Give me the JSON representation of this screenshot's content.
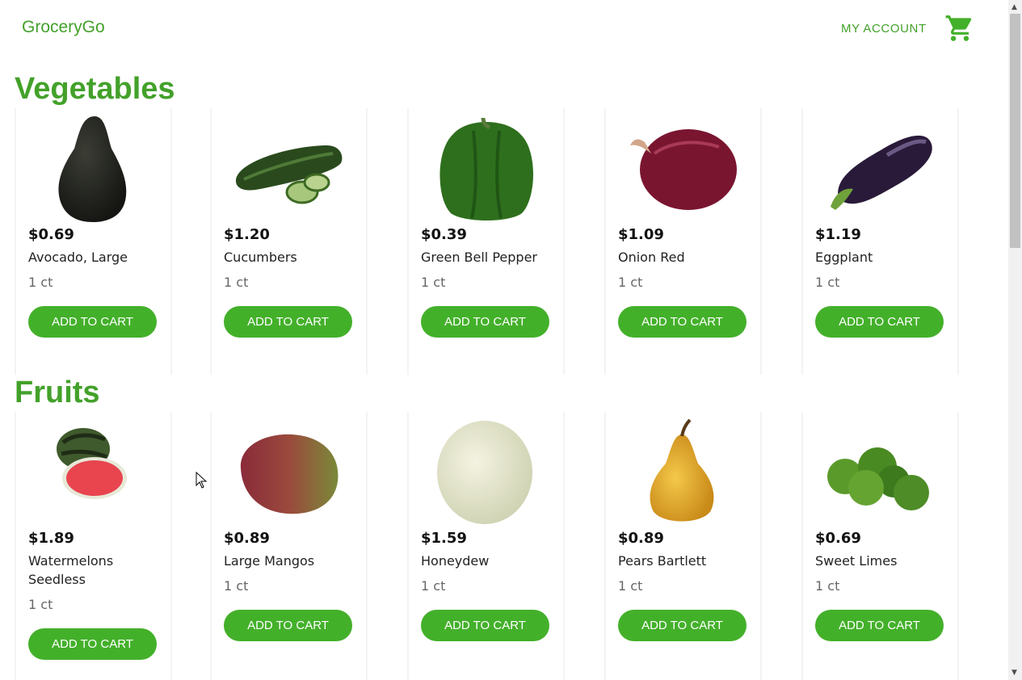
{
  "app": {
    "brand": "GroceryGo",
    "account_label": "MY ACCOUNT",
    "cart_icon": "shopping-cart-icon",
    "accent_color": "#43b02a"
  },
  "sections": [
    {
      "title": "Vegetables",
      "products": [
        {
          "price": "$0.69",
          "name": "Avocado, Large",
          "unit": "1 ct",
          "button": "ADD TO CART",
          "image": "avocado"
        },
        {
          "price": "$1.20",
          "name": "Cucumbers",
          "unit": "1 ct",
          "button": "ADD TO CART",
          "image": "cucumber"
        },
        {
          "price": "$0.39",
          "name": "Green Bell Pepper",
          "unit": "1 ct",
          "button": "ADD TO CART",
          "image": "green-bell-pepper"
        },
        {
          "price": "$1.09",
          "name": "Onion Red",
          "unit": "1 ct",
          "button": "ADD TO CART",
          "image": "red-onion"
        },
        {
          "price": "$1.19",
          "name": "Eggplant",
          "unit": "1 ct",
          "button": "ADD TO CART",
          "image": "eggplant"
        }
      ]
    },
    {
      "title": "Fruits",
      "products": [
        {
          "price": "$1.89",
          "name": "Watermelons Seedless",
          "unit": "1 ct",
          "button": "ADD TO CART",
          "image": "watermelon"
        },
        {
          "price": "$0.89",
          "name": "Large Mangos",
          "unit": "1 ct",
          "button": "ADD TO CART",
          "image": "mango"
        },
        {
          "price": "$1.59",
          "name": "Honeydew",
          "unit": "1 ct",
          "button": "ADD TO CART",
          "image": "honeydew"
        },
        {
          "price": "$0.89",
          "name": "Pears Bartlett",
          "unit": "1 ct",
          "button": "ADD TO CART",
          "image": "pear"
        },
        {
          "price": "$0.69",
          "name": "Sweet Limes",
          "unit": "1 ct",
          "button": "ADD TO CART",
          "image": "limes"
        }
      ]
    }
  ]
}
